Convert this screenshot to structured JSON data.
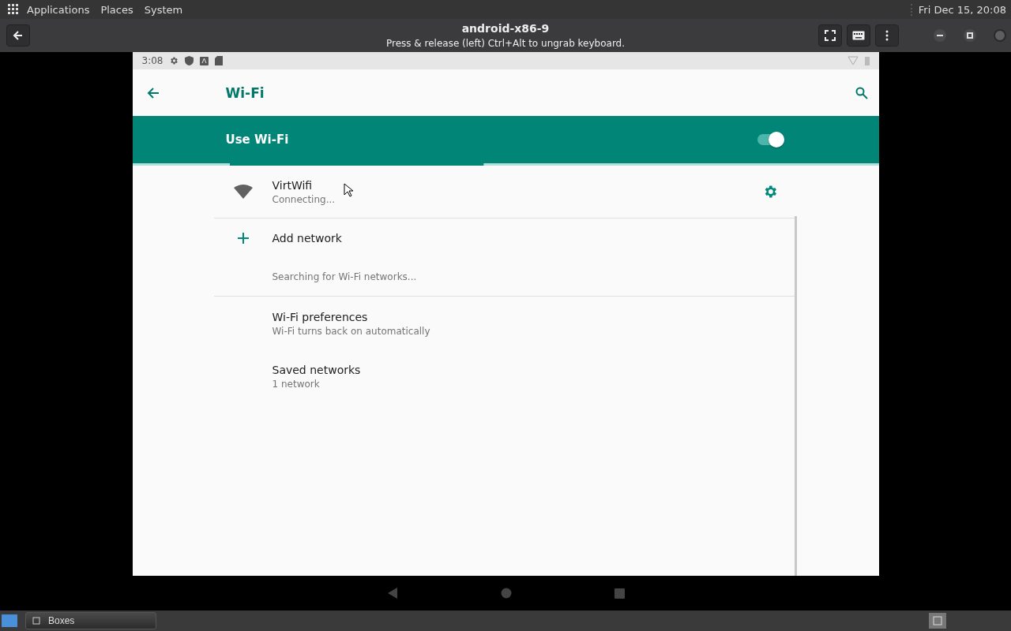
{
  "top_panel": {
    "menus": [
      "Applications",
      "Places",
      "System"
    ],
    "clock": "Fri Dec 15, 20:08"
  },
  "window": {
    "title": "android-x86-9",
    "subtitle": "Press & release (left) Ctrl+Alt to ungrab keyboard."
  },
  "android": {
    "status_bar": {
      "time": "3:08"
    },
    "toolbar": {
      "title": "Wi-Fi"
    },
    "master_switch": {
      "label": "Use Wi-Fi",
      "on": true
    },
    "scan_progress": {
      "level": 0.34
    },
    "networks": [
      {
        "name": "VirtWifi",
        "status": "Connecting..."
      }
    ],
    "add_network": {
      "label": "Add network"
    },
    "searching": "Searching for Wi-Fi networks...",
    "preferences": [
      {
        "title": "Wi-Fi preferences",
        "summary": "Wi-Fi turns back on automatically"
      },
      {
        "title": "Saved networks",
        "summary": "1 network"
      }
    ]
  },
  "taskbar": {
    "items": [
      {
        "label": "Boxes",
        "selected": false
      }
    ]
  }
}
